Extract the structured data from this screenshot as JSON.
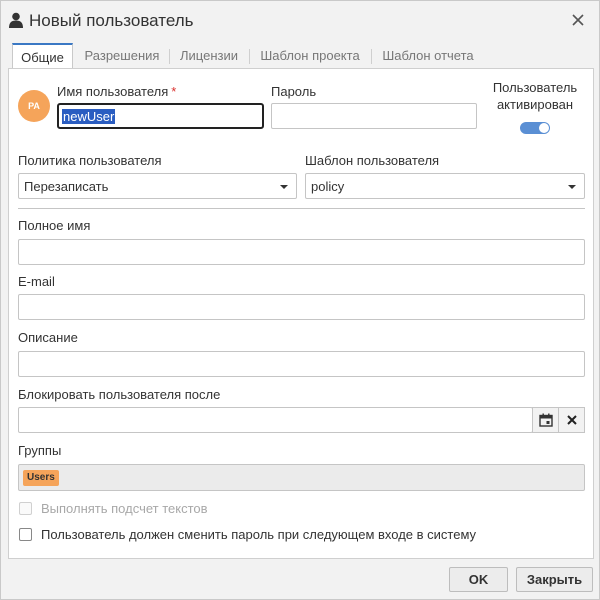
{
  "window": {
    "title": "Новый пользователь"
  },
  "tabs": [
    {
      "label": "Общие"
    },
    {
      "label": "Разрешения"
    },
    {
      "label": "Лицензии"
    },
    {
      "label": "Шаблон проекта"
    },
    {
      "label": "Шаблон отчета"
    }
  ],
  "user": {
    "avatar_initials": "PA",
    "username_label": "Имя пользователя",
    "required_mark": "*",
    "username_value": "newUser",
    "password_label": "Пароль",
    "password_value": "",
    "active_label_line1": "Пользователь",
    "active_label_line2": "активирован",
    "active": true
  },
  "policy": {
    "label": "Политика пользователя",
    "value": "Перезаписать"
  },
  "template": {
    "label": "Шаблон пользователя",
    "value": "policy"
  },
  "full_name": {
    "label": "Полное имя",
    "value": ""
  },
  "email": {
    "label": "E-mail",
    "value": ""
  },
  "description": {
    "label": "Описание",
    "value": ""
  },
  "block_after": {
    "label": "Блокировать пользователя после",
    "value": ""
  },
  "groups": {
    "label": "Группы",
    "items": [
      "Users"
    ]
  },
  "options": {
    "count_texts": {
      "label": "Выполнять подсчет текстов",
      "checked": false,
      "disabled": true
    },
    "must_change_password": {
      "label": "Пользователь должен сменить пароль при следующем входе в систему",
      "checked": false,
      "disabled": false
    }
  },
  "buttons": {
    "ok": "OK",
    "close": "Закрыть"
  },
  "colors": {
    "accent": "#3a78c4",
    "avatar": "#f5a45a",
    "toggle_on": "#5a8fd4",
    "required": "#d9302c",
    "selection": "#2a5dc1"
  },
  "icons": {
    "title": "user-icon",
    "close": "close-icon",
    "calendar": "calendar-icon",
    "clear": "clear-x-icon",
    "dropdown": "chevron-down-icon"
  }
}
